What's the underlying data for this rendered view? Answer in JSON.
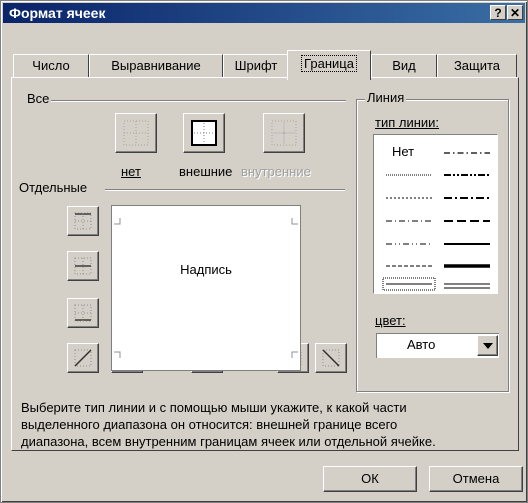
{
  "window": {
    "title": "Формат ячеек",
    "help_label": "?",
    "close_label": "✕"
  },
  "tabs": [
    {
      "label": "Число"
    },
    {
      "label": "Выравнивание"
    },
    {
      "label": "Шрифт"
    },
    {
      "label": "Граница",
      "active": true
    },
    {
      "label": "Вид"
    },
    {
      "label": "Защита"
    }
  ],
  "presets": {
    "group_label": "Все",
    "none_label": "нет",
    "outline_label": "внешние",
    "inside_label": "внутренние"
  },
  "border": {
    "group_label": "Отдельные",
    "preview_text": "Надпись"
  },
  "line": {
    "group_label": "Линия",
    "style_label": "тип линии:",
    "none_text": "Нет",
    "color_label": "цвет:",
    "color_value": "Авто"
  },
  "hint": {
    "line1": "Выберите тип линии и с помощью мыши укажите, к какой части",
    "line2": "выделенного диапазона он относится: внешней границе всего",
    "line3": "диапазона, всем внутренним границам ячеек или отдельной ячейке."
  },
  "buttons": {
    "ok_label": "ОК",
    "cancel_label": "Отмена"
  },
  "colors": {
    "titlebar": "#0a246a",
    "face": "#d4d0c8"
  }
}
